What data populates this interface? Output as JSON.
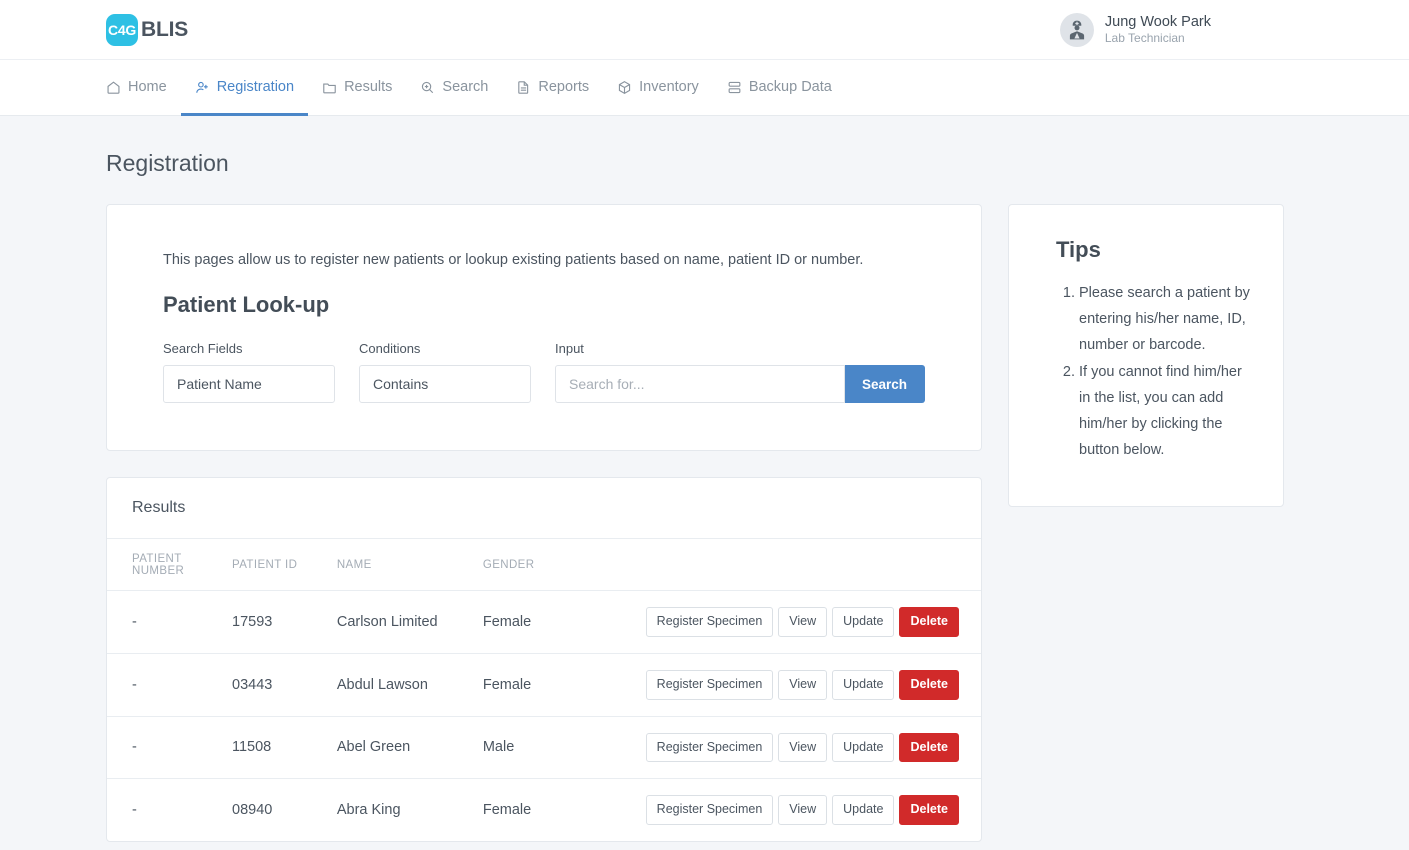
{
  "brand": {
    "badge": "C4G",
    "name": "BLIS"
  },
  "user": {
    "name": "Jung Wook Park",
    "role": "Lab Technician",
    "avatar_icon": "doctor-avatar-icon"
  },
  "nav": {
    "items": [
      {
        "label": "Home",
        "icon": "home-icon",
        "active": false
      },
      {
        "label": "Registration",
        "icon": "user-plus-icon",
        "active": true
      },
      {
        "label": "Results",
        "icon": "folder-icon",
        "active": false
      },
      {
        "label": "Search",
        "icon": "search-zoom-icon",
        "active": false
      },
      {
        "label": "Reports",
        "icon": "document-icon",
        "active": false
      },
      {
        "label": "Inventory",
        "icon": "cube-icon",
        "active": false
      },
      {
        "label": "Backup Data",
        "icon": "database-icon",
        "active": false
      }
    ]
  },
  "page": {
    "title": "Registration"
  },
  "lookup": {
    "intro": "This pages allow us to register new patients or lookup existing patients based on name, patient ID or number.",
    "title": "Patient Look-up",
    "search_fields": {
      "label": "Search Fields",
      "value": "Patient Name"
    },
    "conditions": {
      "label": "Conditions",
      "value": "Contains"
    },
    "input": {
      "label": "Input",
      "placeholder": "Search for...",
      "value": ""
    },
    "search_button": "Search"
  },
  "results": {
    "title": "Results",
    "columns": [
      "PATIENT NUMBER",
      "PATIENT ID",
      "NAME",
      "GENDER"
    ],
    "actions": {
      "register_specimen": "Register Specimen",
      "view": "View",
      "update": "Update",
      "delete": "Delete"
    },
    "rows": [
      {
        "patient_number": "-",
        "patient_id": "17593",
        "name": "Carlson Limited",
        "gender": "Female"
      },
      {
        "patient_number": "-",
        "patient_id": "03443",
        "name": "Abdul Lawson",
        "gender": "Female"
      },
      {
        "patient_number": "-",
        "patient_id": "11508",
        "name": "Abel Green",
        "gender": "Male"
      },
      {
        "patient_number": "-",
        "patient_id": "08940",
        "name": "Abra King",
        "gender": "Female"
      }
    ]
  },
  "tips": {
    "title": "Tips",
    "items": [
      "Please search a patient by entering his/her name, ID, number or barcode.",
      "If you cannot find him/her in the list, you can add him/her by clicking the button below."
    ]
  },
  "colors": {
    "brand_badge": "#2ec0e4",
    "accent_blue": "#4a86c8",
    "danger_red": "#d12a2a",
    "page_bg": "#f4f6f9"
  }
}
